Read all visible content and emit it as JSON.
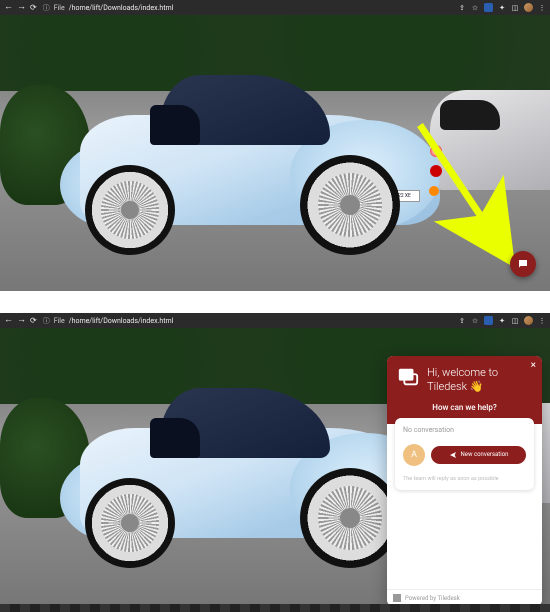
{
  "browser": {
    "file_label": "File",
    "url": "/home/lift/Downloads/index.html"
  },
  "plate": "GN22 XE",
  "chat": {
    "welcome_line1": "Hi, welcome to",
    "welcome_line2": "Tiledesk 👋",
    "subtitle": "How can we help?",
    "no_conversation": "No conversation",
    "avatar_letter": "A",
    "new_conversation": "New conversation",
    "reply_note": "The team will reply as soon as possible",
    "powered_by": "Powered by Tiledesk"
  }
}
